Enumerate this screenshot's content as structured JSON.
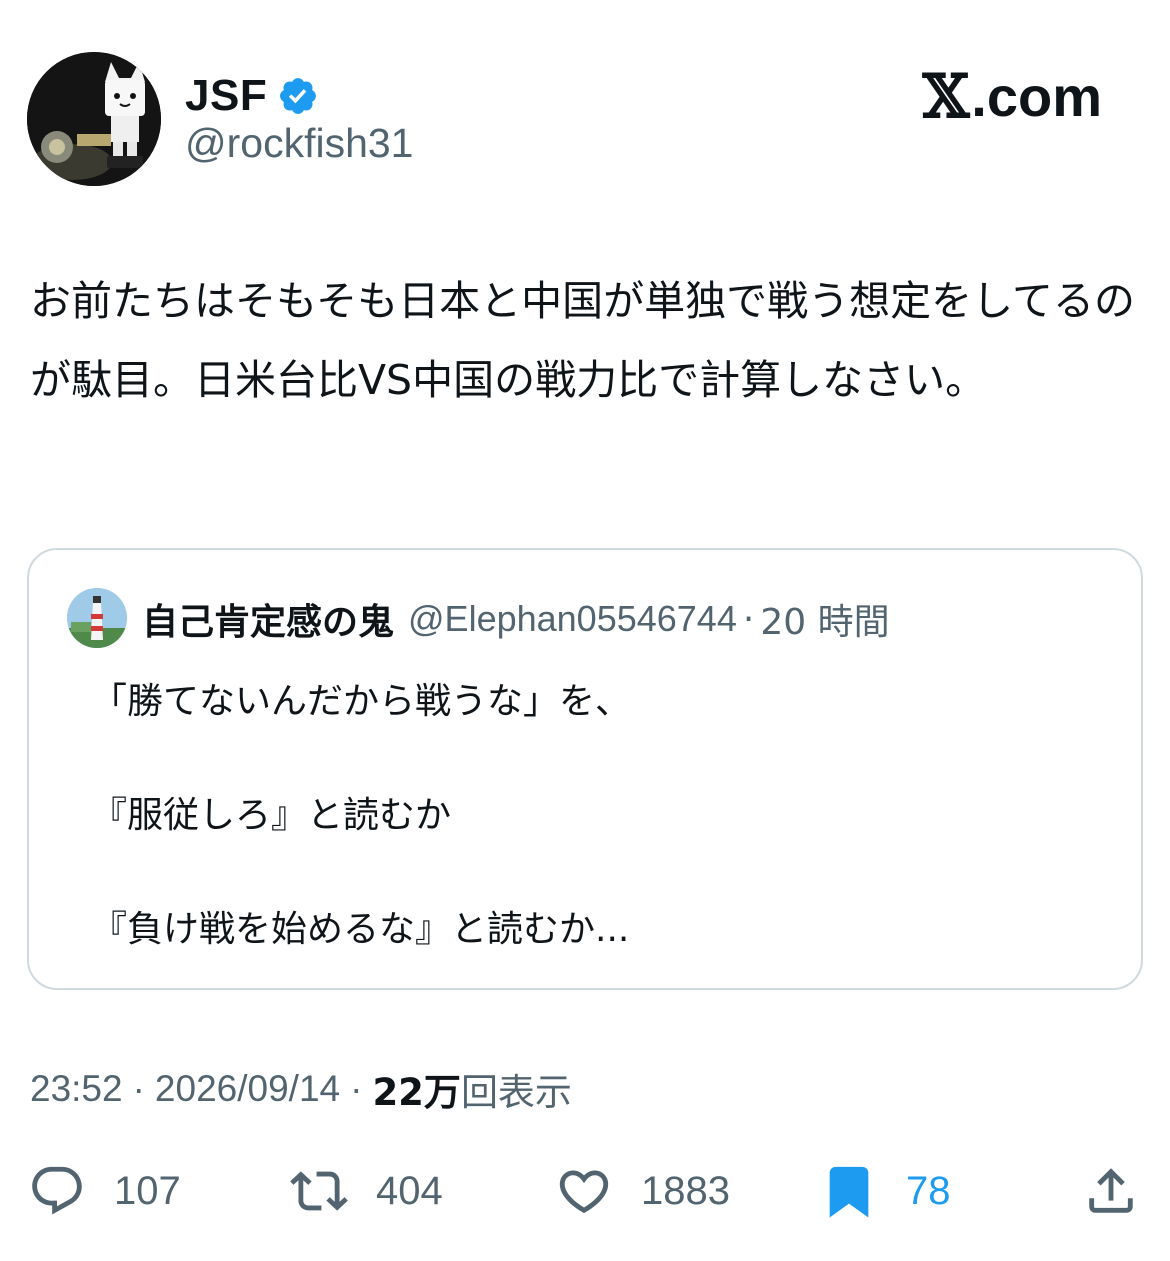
{
  "author": {
    "display_name": "JSF",
    "handle": "@rockfish31",
    "verified": true,
    "avatar": "cat-figure-avatar"
  },
  "brand": {
    "mark": "𝕏",
    "text": ".com"
  },
  "tweet": {
    "text": "お前たちはそもそも日本と中国が単独で戦う想定をしてるのが駄目。日米台比VS中国の戦力比で計算しなさい。"
  },
  "quoted": {
    "display_name": "自己肯定感の鬼",
    "handle": "@Elephan05546744",
    "separator": "·",
    "time": "20 時間",
    "lines": [
      "「勝てないんだから戦うな」を、",
      "『服従しろ』と読むか",
      "『負け戦を始めるな』と読むか..."
    ]
  },
  "meta": {
    "time": "23:52",
    "date": "2026/09/14",
    "separator": "·",
    "views_count": "22万",
    "views_label": "回表示"
  },
  "actions": {
    "replies": "107",
    "retweets": "404",
    "likes": "1883",
    "bookmarks": "78"
  },
  "colors": {
    "text": "#0f1419",
    "secondary": "#536471",
    "accent": "#1d9bf0",
    "border": "#cfd9de"
  }
}
